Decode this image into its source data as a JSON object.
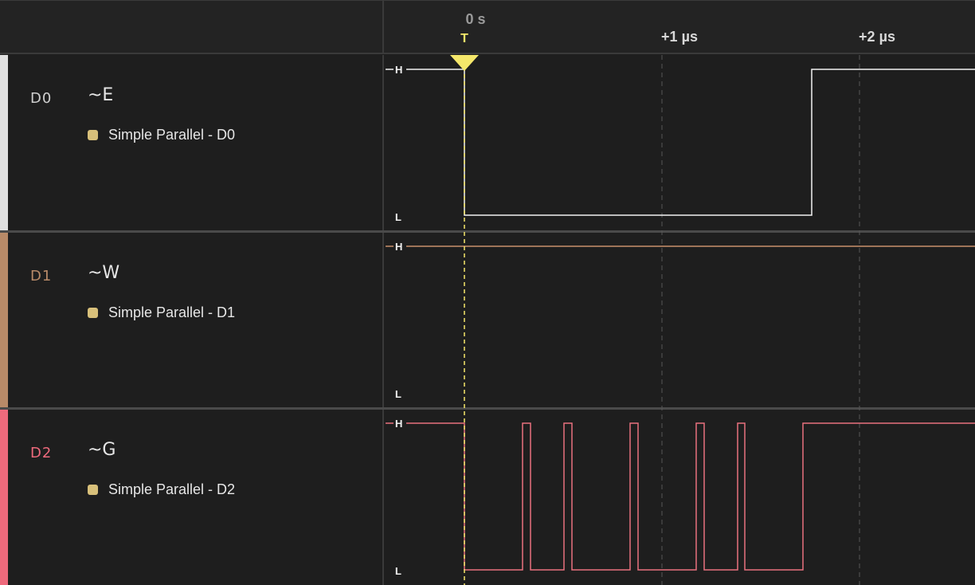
{
  "timeline": {
    "zero_label": "0 s",
    "trigger_label": "T",
    "markers": [
      "+1 µs",
      "+2 µs"
    ]
  },
  "level_labels": {
    "high": "H",
    "low": "L"
  },
  "colors": {
    "trigger": "#f5e76a",
    "d0": "#f2f2f2",
    "d1": "#c8916b",
    "d2": "#e8707e",
    "analyzer_dot": "#d8c07a"
  },
  "channels": [
    {
      "id": "D0",
      "name": "~E",
      "analyzer": "Simple Parallel - D0"
    },
    {
      "id": "D1",
      "name": "~W",
      "analyzer": "Simple Parallel - D1"
    },
    {
      "id": "D2",
      "name": "~G",
      "analyzer": "Simple Parallel - D2"
    }
  ]
}
